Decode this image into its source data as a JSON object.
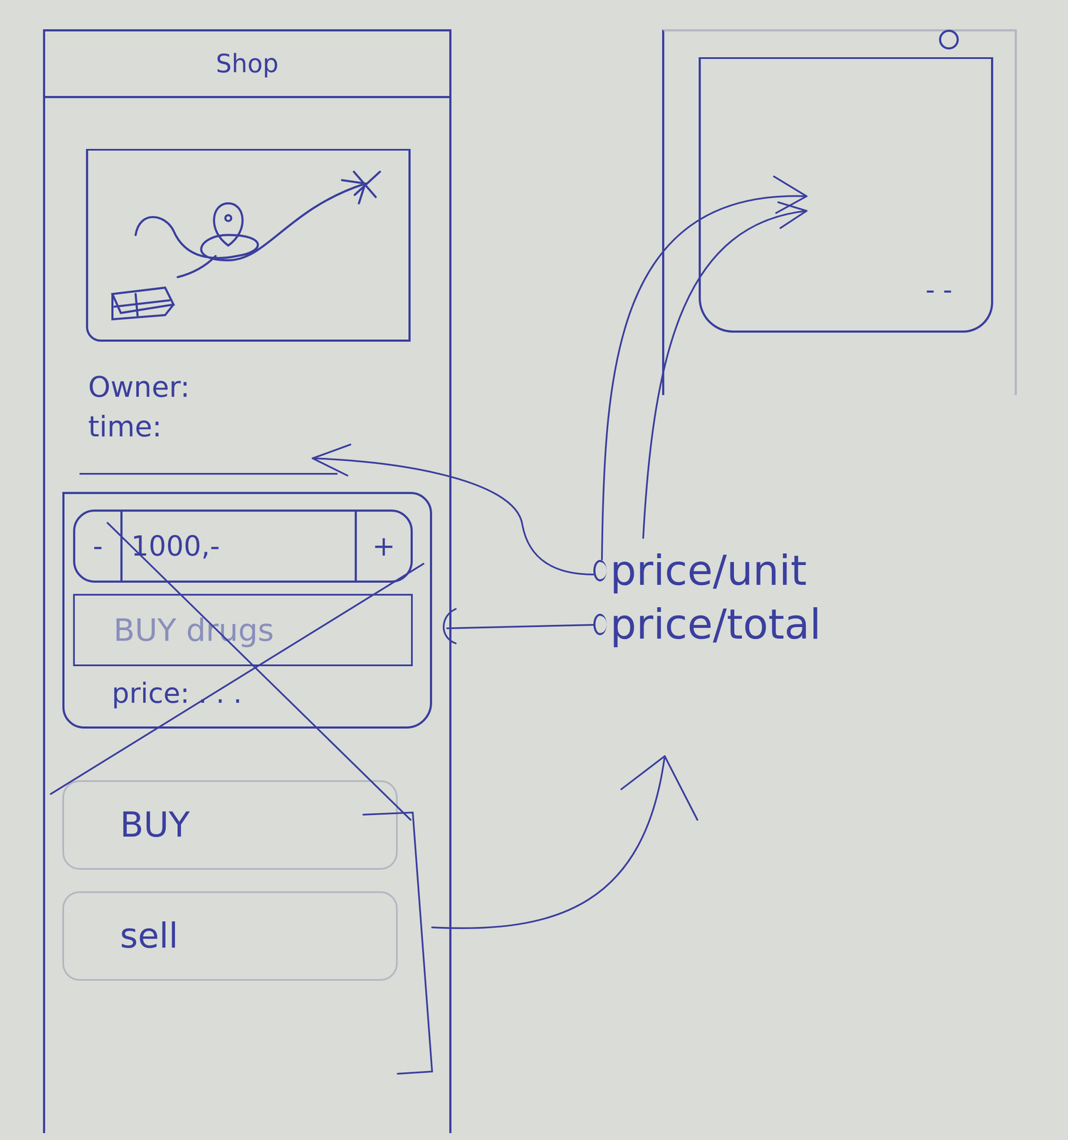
{
  "shop": {
    "title": "Shop",
    "info": [
      "Owner:",
      "time:"
    ],
    "order": {
      "crossed": true,
      "stepper": {
        "minus": "-",
        "value": "1000,-",
        "plus": "+"
      },
      "button": "BUY drugs",
      "price": "price: . . ."
    },
    "actions": [
      "BUY",
      "sell"
    ]
  },
  "annotations": [
    {
      "label": "price/unit"
    },
    {
      "label": "price/total"
    }
  ],
  "detail": {
    "footer": "- -"
  }
}
